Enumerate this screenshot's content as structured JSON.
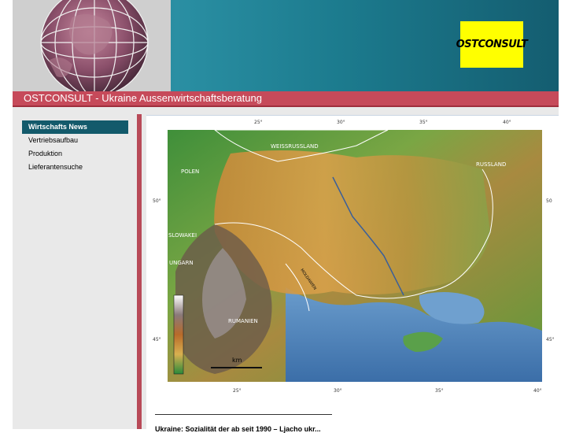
{
  "header": {
    "logo_text": "OSTCONSULT"
  },
  "title_bar": {
    "text": "OSTCONSULT - Ukraine Aussenwirtschaftsberatung"
  },
  "nav": {
    "items": [
      {
        "label": "Wirtschafts News",
        "active": true
      },
      {
        "label": "Vertriebsaufbau",
        "active": false
      },
      {
        "label": "Produktion",
        "active": false
      },
      {
        "label": "Lieferantensuche",
        "active": false
      }
    ]
  },
  "map": {
    "top_ticks": [
      "25°",
      "30°",
      "35°",
      "40°"
    ],
    "bottom_ticks": [
      "25°",
      "30°",
      "35°",
      "40°"
    ],
    "left_ticks": [
      "50°",
      "45°"
    ],
    "right_ticks": [
      "50",
      "45°"
    ],
    "country_labels": {
      "weissrussland": "WEISSRUSSLAND",
      "polen": "POLEN",
      "russland": "RUSSLAND",
      "slowakei": "SLOWAKEI",
      "ungarn": "UNGARN",
      "rumanien": "RUMANIEN",
      "moldawien": "MOLDAWIEN"
    },
    "scale_label": "km"
  },
  "content": {
    "headline": "Ukraine: Sozialität der ab seit 1990 – Ljacho ukr..."
  },
  "colors": {
    "header_teal": "#1a6e83",
    "title_red": "#c64a5a",
    "nav_active": "#135a6b",
    "logo_yellow": "#ffff00"
  }
}
